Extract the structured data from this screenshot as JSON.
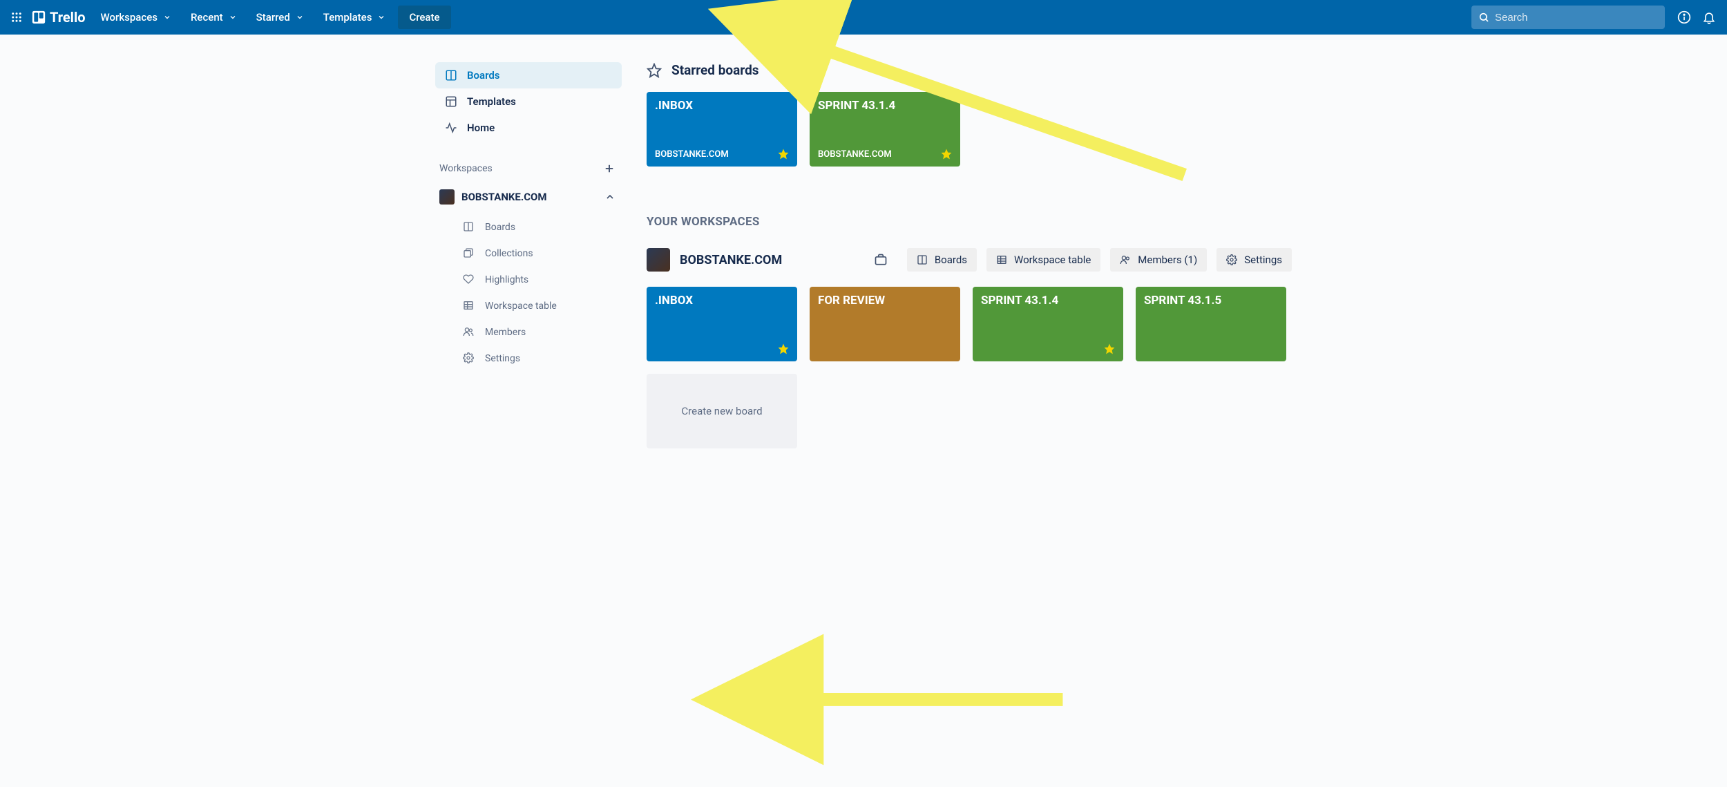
{
  "brand": "Trello",
  "topbar": {
    "menus": [
      "Workspaces",
      "Recent",
      "Starred",
      "Templates"
    ],
    "create": "Create",
    "search_placeholder": "Search"
  },
  "sidebar": {
    "nav": [
      {
        "icon": "board",
        "label": "Boards",
        "selected": true
      },
      {
        "icon": "template",
        "label": "Templates",
        "selected": false
      },
      {
        "icon": "pulse",
        "label": "Home",
        "selected": false
      }
    ],
    "workspaces_label": "Workspaces",
    "workspace": {
      "name": "BOBSTANKE.COM",
      "expanded": true,
      "items": [
        {
          "icon": "board",
          "label": "Boards"
        },
        {
          "icon": "collection",
          "label": "Collections"
        },
        {
          "icon": "heart",
          "label": "Highlights"
        },
        {
          "icon": "table",
          "label": "Workspace table"
        },
        {
          "icon": "members",
          "label": "Members"
        },
        {
          "icon": "gear",
          "label": "Settings"
        }
      ]
    }
  },
  "starred": {
    "heading": "Starred boards",
    "cards": [
      {
        "title": ".INBOX",
        "subtitle": "BOBSTANKE.COM",
        "color": "blue",
        "starred": true
      },
      {
        "title": "SPRINT 43.1.4",
        "subtitle": "BOBSTANKE.COM",
        "color": "green",
        "starred": true
      }
    ]
  },
  "workspaces_section": {
    "heading": "YOUR WORKSPACES",
    "name": "BOBSTANKE.COM",
    "buttons": [
      {
        "icon": "board",
        "label": "Boards"
      },
      {
        "icon": "table",
        "label": "Workspace table"
      },
      {
        "icon": "members",
        "label": "Members (1)"
      },
      {
        "icon": "gear",
        "label": "Settings"
      }
    ],
    "cards": [
      {
        "title": ".INBOX",
        "color": "blue",
        "starred": true
      },
      {
        "title": "FOR REVIEW",
        "color": "orange",
        "starred": false
      },
      {
        "title": "SPRINT 43.1.4",
        "color": "green",
        "starred": true
      },
      {
        "title": "SPRINT 43.1.5",
        "color": "green",
        "starred": false
      }
    ],
    "create_label": "Create new board"
  }
}
